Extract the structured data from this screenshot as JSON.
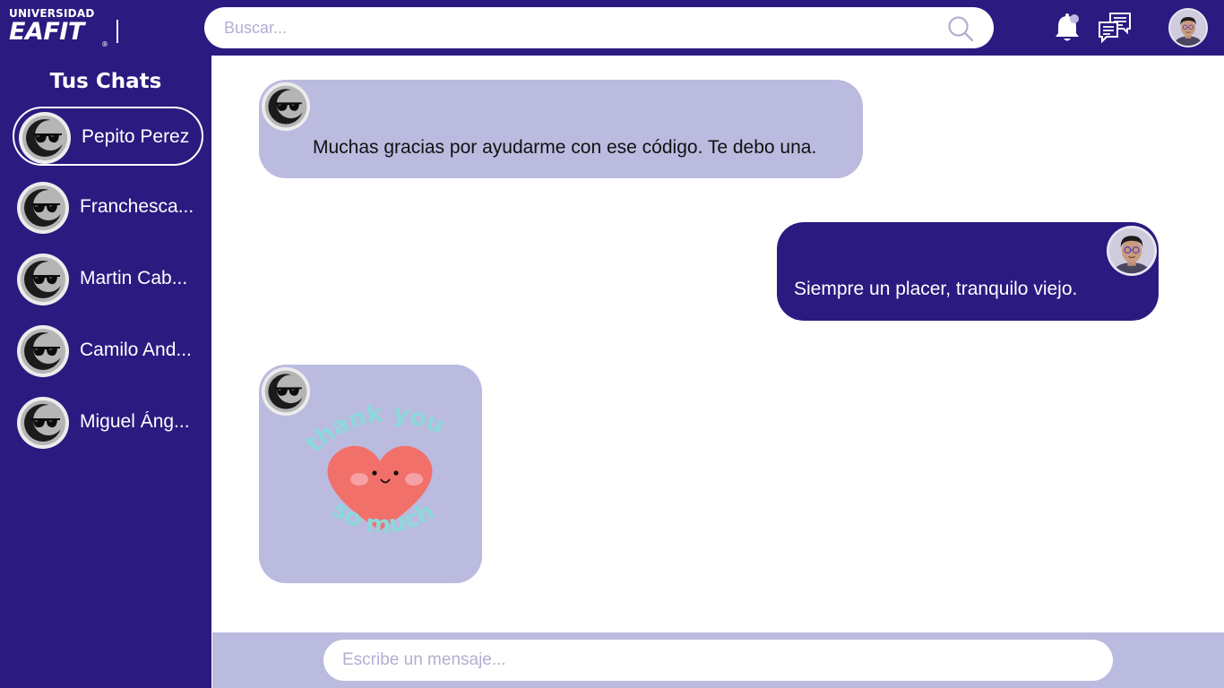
{
  "brand": {
    "line1": "UNIVERSIDAD",
    "line2": "EAFIT",
    "registered": "®"
  },
  "header": {
    "search_placeholder": "Buscar...",
    "icons": [
      "search-icon",
      "notification-bell-icon",
      "chat-bubbles-icon",
      "user-avatar"
    ]
  },
  "sidebar": {
    "title": "Tus Chats",
    "chats": [
      {
        "name": "Pepito Perez",
        "active": true
      },
      {
        "name": "Franchesca...",
        "active": false
      },
      {
        "name": "Martin Cab...",
        "active": false
      },
      {
        "name": "Camilo And...",
        "active": false
      },
      {
        "name": "Miguel Áng...",
        "active": false
      }
    ]
  },
  "conversation": {
    "messages": [
      {
        "direction": "incoming",
        "text": "Muchas gracias por ayudarme con ese código. Te debo una."
      },
      {
        "direction": "outgoing",
        "text": "Siempre un placer, tranquilo viejo."
      },
      {
        "direction": "incoming",
        "sticker": "thank-you-heart-sticker",
        "sticker_text_top": "thank you",
        "sticker_text_bottom": "so much"
      }
    ]
  },
  "composer": {
    "placeholder": "Escribe un mensaje..."
  },
  "colors": {
    "primary": "#2b1a80",
    "bubble_incoming": "#bbbadf",
    "bubble_outgoing": "#2b1a80",
    "background": "#ffffff",
    "sticker_heart": "#f2706a",
    "sticker_text": "#8ed8dc"
  }
}
